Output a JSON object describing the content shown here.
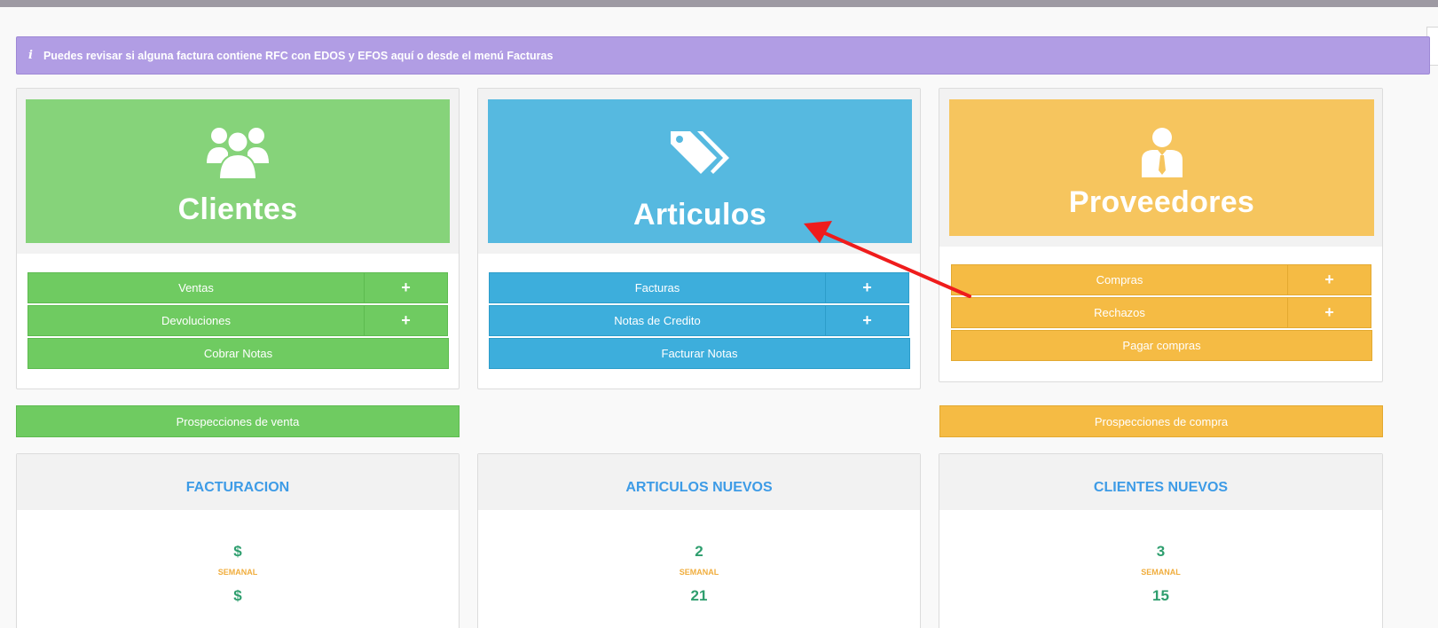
{
  "alert": {
    "icon": "info-icon",
    "text": "Puedes revisar si alguna factura contiene RFC con EDOS y EFOS aquí o desde el menú Facturas"
  },
  "clientes": {
    "title": "Clientes",
    "icon": "users-icon",
    "ventas": "Ventas",
    "devoluciones": "Devoluciones",
    "cobrar": "Cobrar Notas",
    "plus": "+",
    "color": "#86d37a",
    "button_color": "#6fcb61"
  },
  "articulos": {
    "title": "Articulos",
    "icon": "tags-icon",
    "facturas": "Facturas",
    "notas_credito": "Notas de Credito",
    "facturar": "Facturar Notas",
    "plus": "+",
    "color": "#56b9e0",
    "button_color": "#3daedc"
  },
  "proveedores": {
    "title": "Proveedores",
    "icon": "supplier-icon",
    "compras": "Compras",
    "rechazos": "Rechazos",
    "pagar": "Pagar compras",
    "plus": "+",
    "color": "#f6c55e",
    "button_color": "#f5bb44"
  },
  "prospecciones": {
    "venta": "Prospecciones de venta",
    "compra": "Prospecciones de compra"
  },
  "stats": {
    "facturacion": {
      "title": "FACTURACION",
      "weekly": "$",
      "weekly_label": "SEMANAL",
      "second": "$"
    },
    "articulos_nuevos": {
      "title": "ARTICULOS NUEVOS",
      "weekly": "2",
      "weekly_label": "SEMANAL",
      "second": "21"
    },
    "clientes_nuevos": {
      "title": "CLIENTES NUEVOS",
      "weekly": "3",
      "weekly_label": "SEMANAL",
      "second": "15"
    }
  },
  "annotation": {
    "arrow_color": "#ef1c1c"
  }
}
